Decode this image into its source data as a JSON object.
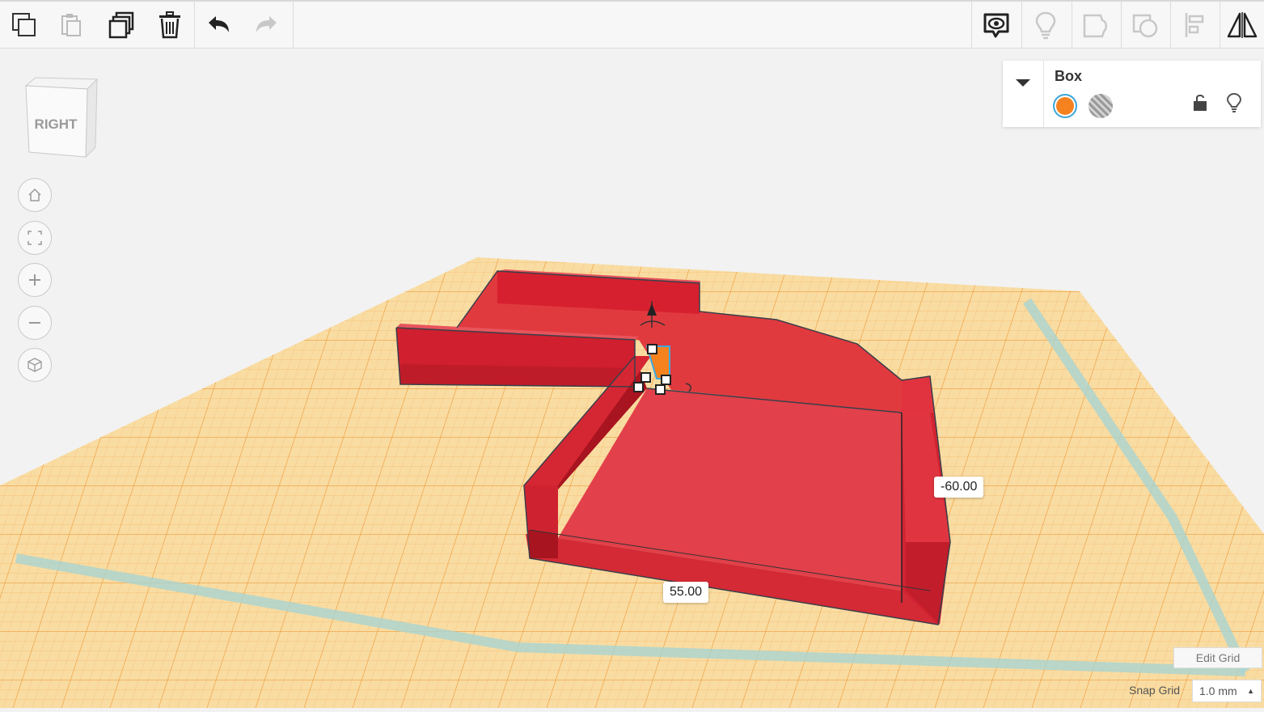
{
  "toolbar": {
    "left_tools": [
      {
        "icon": "copy-icon"
      },
      {
        "icon": "paste-icon"
      },
      {
        "icon": "duplicate-icon"
      },
      {
        "icon": "delete-icon"
      },
      {
        "icon": "undo-icon"
      },
      {
        "icon": "redo-icon"
      }
    ],
    "right_tools": [
      {
        "icon": "notes-visibility-icon"
      },
      {
        "icon": "lightbulb-icon"
      },
      {
        "icon": "group-icon"
      },
      {
        "icon": "ungroup-icon"
      },
      {
        "icon": "align-icon"
      },
      {
        "icon": "mirror-icon"
      }
    ]
  },
  "view_cube": {
    "face_label": "RIGHT"
  },
  "nav_controls": [
    {
      "icon": "home-icon"
    },
    {
      "icon": "fit-view-icon"
    },
    {
      "icon": "zoom-in-icon"
    },
    {
      "icon": "zoom-out-icon"
    },
    {
      "icon": "perspective-icon"
    }
  ],
  "inspector": {
    "title": "Box",
    "solid_color": "#f5821f",
    "hole_label_icon": "hole-stripes-icon",
    "lock_icon": "unlock-icon",
    "visibility_icon": "lightbulb-icon"
  },
  "dimensions": {
    "height_value": "-60.00",
    "width_value": "55.00"
  },
  "grid": {
    "edit_grid_label": "Edit Grid",
    "snap_grid_label": "Snap Grid",
    "snap_grid_value": "1.0 mm"
  },
  "colors": {
    "workplane": "#f9dca2",
    "grid_line": "#f0a44a",
    "shape_red": "#e0303c",
    "shape_dark": "#b81e2a",
    "accent_blue": "#3da9e0"
  }
}
